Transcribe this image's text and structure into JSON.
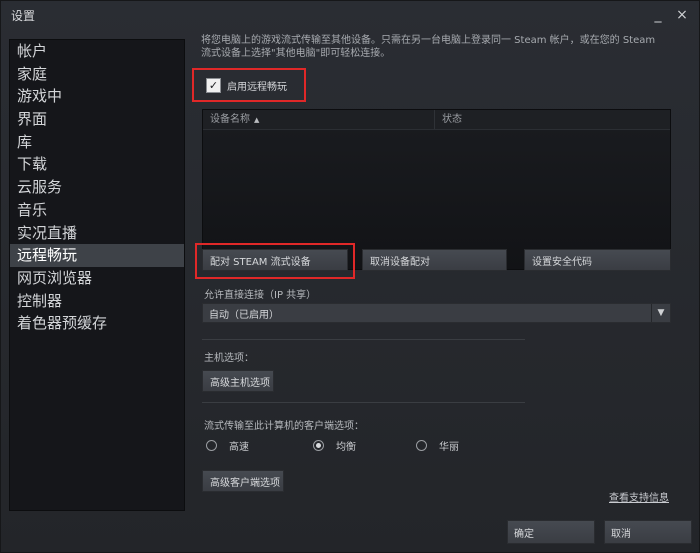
{
  "window": {
    "title": "设置",
    "minimize_glyph": "_",
    "close_glyph": "×"
  },
  "sidebar": {
    "items": [
      {
        "label": "帐户",
        "active": false
      },
      {
        "label": "家庭",
        "active": false
      },
      {
        "label": "游戏中",
        "active": false
      },
      {
        "label": "界面",
        "active": false
      },
      {
        "label": "库",
        "active": false
      },
      {
        "label": "下载",
        "active": false
      },
      {
        "label": "云服务",
        "active": false
      },
      {
        "label": "音乐",
        "active": false
      },
      {
        "label": "实况直播",
        "active": false
      },
      {
        "label": "远程畅玩",
        "active": true
      },
      {
        "label": "网页浏览器",
        "active": false
      },
      {
        "label": "控制器",
        "active": false
      },
      {
        "label": "着色器预缓存",
        "active": false
      }
    ]
  },
  "main": {
    "info_line1": "将您电脑上的游戏流式传输至其他设备。只需在另一台电脑上登录同一 Steam 帐户，或在您的 Steam",
    "info_line2": "流式设备上选择\"其他电脑\"即可轻松连接。",
    "enable_checkbox_label": "启用远程畅玩",
    "enable_checked": true,
    "checkmark_glyph": "✓",
    "table": {
      "col_name": "设备名称",
      "col_status": "状态",
      "sort_glyph": "▲"
    },
    "pair_button": "配对 STEAM 流式设备",
    "unpair_button": "取消设备配对",
    "security_code_button": "设置安全代码",
    "direct_connect_label": "允许直接连接（IP 共享）",
    "direct_connect_value": "自动（已启用）",
    "dropdown_glyph": "▼",
    "host_options_label": "主机选项：",
    "advanced_host_button": "高级主机选项",
    "client_options_label": "流式传输至此计算机的客户端选项：",
    "quality_options": [
      {
        "label": "高速",
        "selected": false
      },
      {
        "label": "均衡",
        "selected": true
      },
      {
        "label": "华丽",
        "selected": false
      }
    ],
    "advanced_client_button": "高级客户端选项",
    "support_link": "查看支持信息"
  },
  "footer": {
    "ok_button": "确定",
    "cancel_button": "取消"
  },
  "colors": {
    "highlight_box": "#e02828",
    "active_sidebar": "#3e4248",
    "sidebar_bg": "#15161a"
  }
}
